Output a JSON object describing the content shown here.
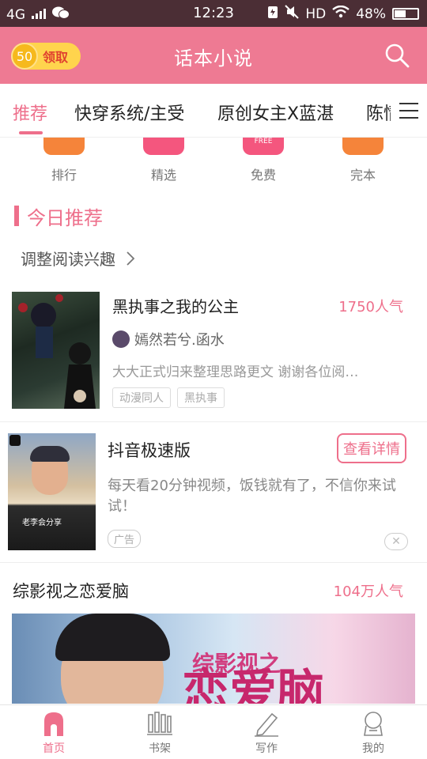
{
  "status_bar": {
    "network": "4G",
    "time": "12:23",
    "hd": "HD",
    "battery": "48%"
  },
  "header": {
    "coin_count": "50",
    "coin_label": "领取",
    "title": "话本小说"
  },
  "tabs": [
    {
      "label": "推荐",
      "active": true
    },
    {
      "label": "快穿系统/主受"
    },
    {
      "label": "原创女主X蓝湛"
    },
    {
      "label": "陈情"
    }
  ],
  "categories": [
    {
      "label": "排行",
      "color": "#f5843a"
    },
    {
      "label": "精选",
      "color": "#f4567e"
    },
    {
      "label": "免费",
      "color": "#f4567e",
      "badge": "FREE"
    },
    {
      "label": "完本",
      "color": "#f5843a"
    }
  ],
  "section": {
    "title": "今日推荐",
    "adjust": "调整阅读兴趣"
  },
  "book1": {
    "title": "黑执事之我的公主",
    "popularity": "1750人气",
    "author": "嫣然若兮.函水",
    "description": "大大正式归来整理思路更文 谢谢各位阅…",
    "tags": [
      "动漫同人",
      "黑执事"
    ]
  },
  "ad": {
    "title": "抖音极速版",
    "detail_button": "查看详情",
    "description": "每天看20分钟视频，饭钱就有了，不信你来试试！",
    "tag": "广告",
    "image_caption": "老李会分享"
  },
  "book2": {
    "title": "综影视之恋爱脑",
    "popularity": "104万人气",
    "banner_line1": "综影视之",
    "banner_line2": "恋爱脑"
  },
  "bottom_nav": [
    {
      "label": "首页",
      "active": true
    },
    {
      "label": "书架"
    },
    {
      "label": "写作"
    },
    {
      "label": "我的"
    }
  ],
  "colors": {
    "brand": "#ee7a93",
    "accent": "#ee6f8b",
    "status_bar": "#4b2e35"
  }
}
